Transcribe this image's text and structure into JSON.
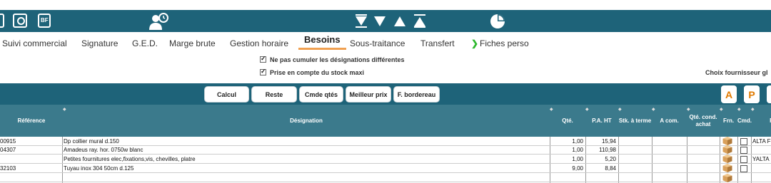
{
  "toolbar": {
    "icons": [
      "document-icon",
      "search-folder-icon",
      "bf-document-icon",
      "person-clock-icon",
      "sort-icons",
      "pie-chart-icon"
    ],
    "bf_text": "BF"
  },
  "tabs": [
    {
      "label": "Suivi commercial"
    },
    {
      "label": "Signature"
    },
    {
      "label": "G.E.D."
    },
    {
      "label": "Marge brute"
    },
    {
      "label": "Gestion horaire"
    },
    {
      "label": "Besoins",
      "active": true
    },
    {
      "label": "Sous-traitance"
    },
    {
      "label": "Transfert"
    },
    {
      "label": "Fiches perso"
    }
  ],
  "options": {
    "no_cumul": "Ne pas cumuler les désignations différentes",
    "stock_maxi": "Prise en compte du stock maxi",
    "choix_fournisseur": "Choix fournisseur gl"
  },
  "buttons": {
    "calcul": "Calcul",
    "reste": "Reste",
    "cmde_qtes": "Cmde qtés",
    "meilleur_prix": "Meilleur prix",
    "f_bordereau": "F. bordereau",
    "pdf_a": "A",
    "pdf_p": "P"
  },
  "columns": {
    "reference": "Référence",
    "designation": "Désignation",
    "qte": "Qté.",
    "pa_ht": "P.A. HT",
    "stk_terme": "Stk. à terme",
    "a_com": "A com.",
    "qte_cond_achat": "Qté. cond. achat",
    "frn": "Frn.",
    "cmd": "Cmd.",
    "f": "F"
  },
  "rows": [
    {
      "ref": "00915",
      "designation": "Dp collier mural d.150",
      "qte": "1,00",
      "pa_ht": "15,94",
      "fournisseur": "ALTA F"
    },
    {
      "ref": "04307",
      "designation": "Amadeus ray. hor. 0750w blanc",
      "qte": "1,00",
      "pa_ht": "110,98",
      "fournisseur": ""
    },
    {
      "ref": "",
      "designation": "Petites fournitures elec,fixations,vis, chevilles, platre",
      "qte": "1,00",
      "pa_ht": "5,20",
      "fournisseur": "YALTA"
    },
    {
      "ref": "32103",
      "designation": "Tuyau inox 304 50cm d.125",
      "qte": "9,00",
      "pa_ht": "8,84",
      "fournisseur": ""
    }
  ],
  "colors": {
    "toolbar_bg": "#1e6379",
    "header_bg": "#3b7a8c",
    "active_tab_underline": "#f0a050",
    "fiches_arrow": "#2db82d"
  }
}
